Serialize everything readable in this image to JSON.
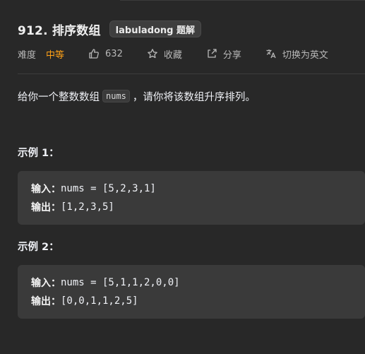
{
  "problem": {
    "title": "912. 排序数组",
    "badge": "labuladong 题解",
    "difficulty_label": "难度",
    "difficulty_value": "中等",
    "difficulty_color": "#ffa116",
    "like_count": "632",
    "favorite_label": "收藏",
    "share_label": "分享",
    "translate_label": "切换为英文"
  },
  "icons": {
    "like": "thumbs-up-icon",
    "favorite": "star-icon",
    "share": "share-icon",
    "translate": "translate-icon"
  },
  "description": {
    "before": "给你一个整数数组",
    "code": "nums",
    "after": "，请你将该数组升序排列。"
  },
  "examples": [
    {
      "heading": "示例 1：",
      "input_label": "输入：",
      "input_value": "nums = [5,2,3,1]",
      "output_label": "输出：",
      "output_value": "[1,2,3,5]"
    },
    {
      "heading": "示例 2：",
      "input_label": "输入：",
      "input_value": "nums = [5,1,1,2,0,0]",
      "output_label": "输出：",
      "output_value": "[0,0,1,1,2,5]"
    }
  ]
}
